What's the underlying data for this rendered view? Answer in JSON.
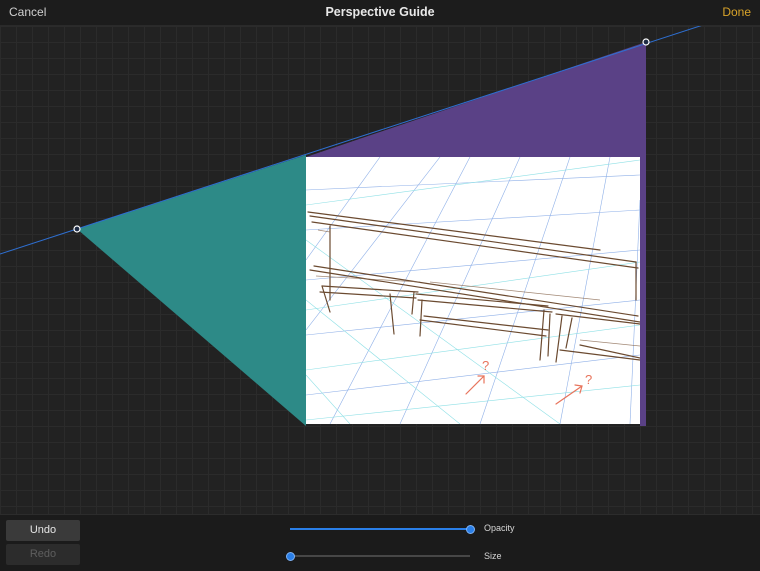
{
  "header": {
    "cancel_label": "Cancel",
    "title": "Perspective Guide",
    "done_label": "Done"
  },
  "canvas": {
    "guide_colors": {
      "left_plane": "#2d8a87",
      "right_plane": "#5a4186",
      "horizon_line": "#2e6fd1"
    },
    "vanishing_points": 2,
    "sketch_annotations": [
      "?",
      "?"
    ]
  },
  "controls": {
    "undo_label": "Undo",
    "redo_label": "Redo",
    "opacity": {
      "label": "Opacity",
      "value": 1.0
    },
    "size": {
      "label": "Size",
      "value": 0.0
    }
  }
}
